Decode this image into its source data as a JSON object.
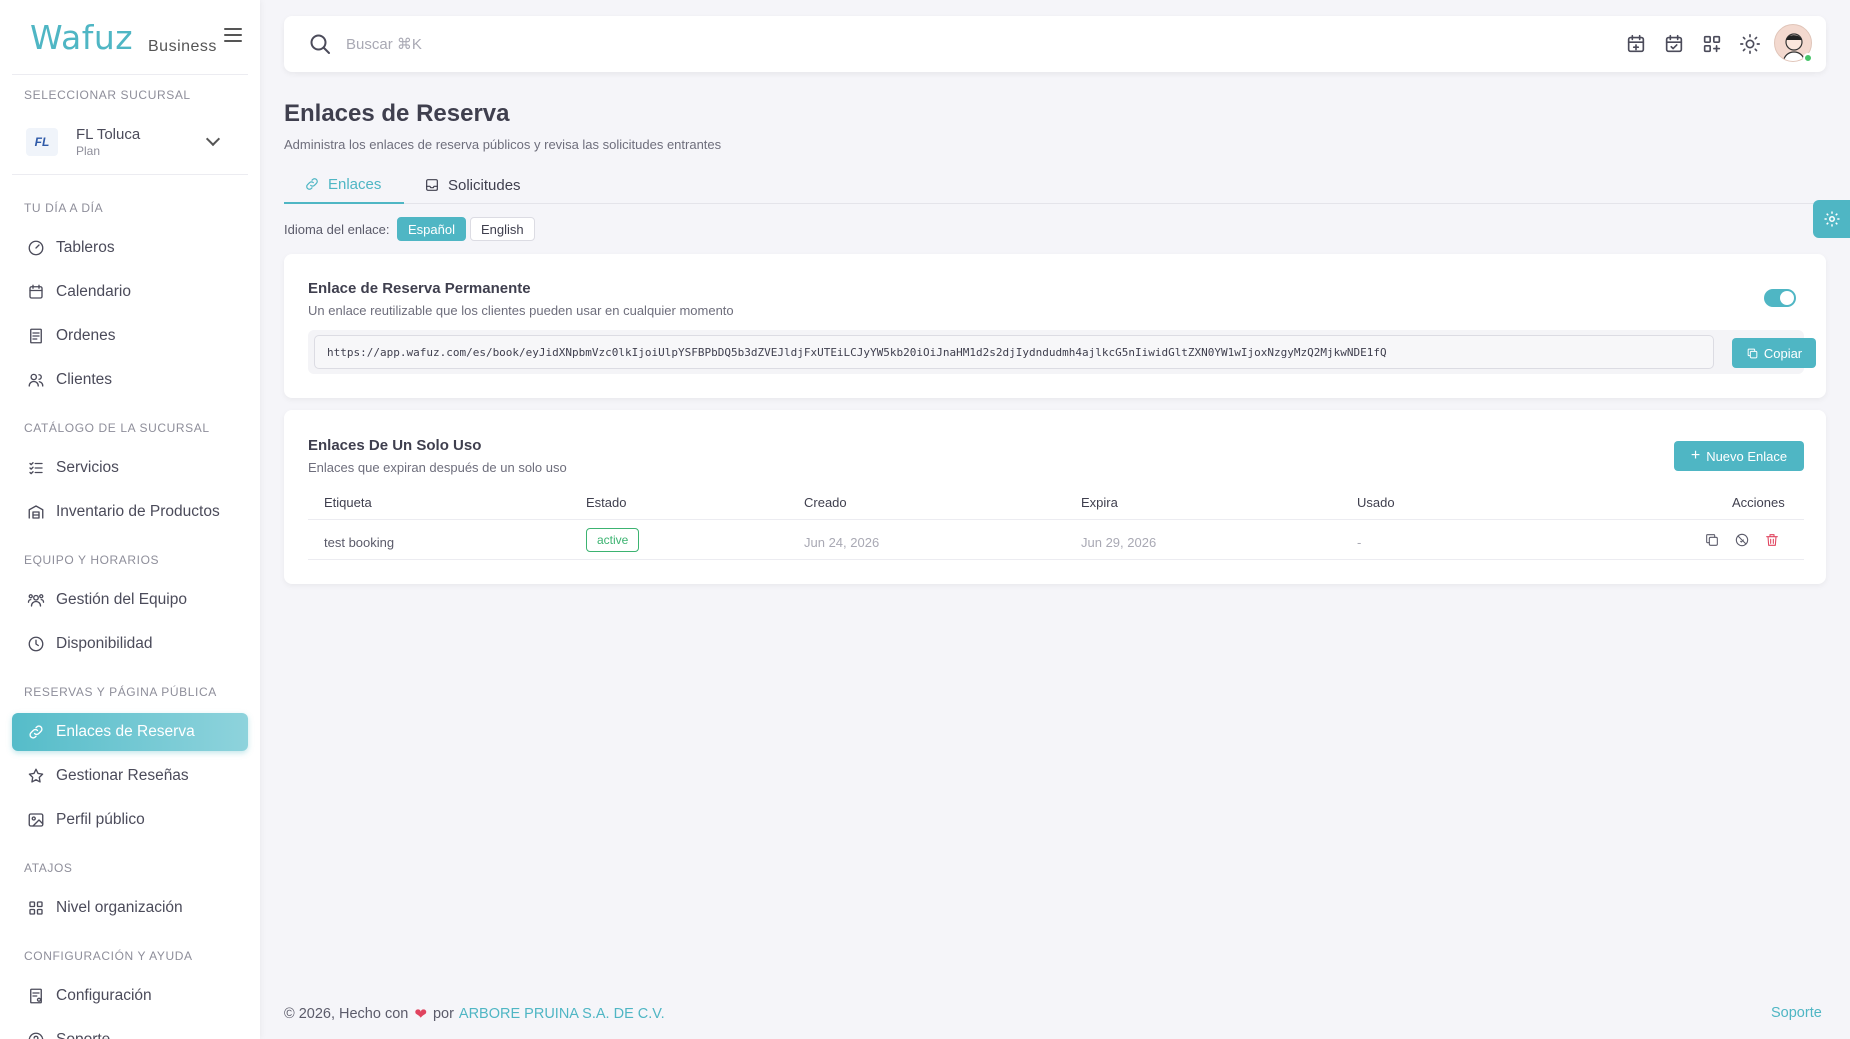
{
  "brand": {
    "logo": "Wafuz",
    "sub": "Business"
  },
  "colors": {
    "accent": "#4fb6c4",
    "active_badge": "#3cb371",
    "danger": "#e0445f"
  },
  "sidebar": {
    "branch_section": "SELECCIONAR SUCURSAL",
    "branch": {
      "logo_text": "FL",
      "name": "FL Toluca",
      "plan": "Plan"
    },
    "sections": {
      "daily": "TU DÍA A DÍA",
      "catalog": "CATÁLOGO DE LA SUCURSAL",
      "team": "EQUIPO Y HORARIOS",
      "bookings": "RESERVAS Y PÁGINA PÚBLICA",
      "shortcuts": "ATAJOS",
      "config": "CONFIGURACIÓN Y AYUDA"
    },
    "items": {
      "tableros": "Tableros",
      "calendario": "Calendario",
      "ordenes": "Ordenes",
      "clientes": "Clientes",
      "servicios": "Servicios",
      "inventario": "Inventario de Productos",
      "gestion_equipo": "Gestión del Equipo",
      "disponibilidad": "Disponibilidad",
      "enlaces": "Enlaces de Reserva",
      "resenas": "Gestionar Reseñas",
      "perfil": "Perfil público",
      "nivel": "Nivel organización",
      "configuracion": "Configuración",
      "soporte": "Soporte"
    }
  },
  "search": {
    "placeholder": "Buscar ⌘K",
    "value": ""
  },
  "page": {
    "title": "Enlaces de Reserva",
    "subtitle": "Administra los enlaces de reserva públicos y revisa las solicitudes entrantes",
    "tabs": {
      "links": "Enlaces",
      "requests": "Solicitudes"
    },
    "language": {
      "label": "Idioma del enlace:",
      "es": "Español",
      "en": "English",
      "selected": "Español"
    }
  },
  "permanent": {
    "title": "Enlace de Reserva Permanente",
    "desc": "Un enlace reutilizable que los clientes pueden usar en cualquier momento",
    "enabled": true,
    "url": "https://app.wafuz.com/es/book/eyJidXNpbmVzc0lkIjoiUlpYSFBPbDQ5b3dZVEJldjFxUTEiLCJyYW5kb20iOiJnaHM1d2s2djIydndudmh4ajlkcG5nIiwidGltZXN0YW1wIjoxNzgyMzQ2MjkwNDE1fQ",
    "copy_label": "Copiar"
  },
  "single_use": {
    "title": "Enlaces De Un Solo Uso",
    "desc": "Enlaces que expiran después de un solo uso",
    "new_label": "Nuevo Enlace",
    "columns": {
      "label": "Etiqueta",
      "status": "Estado",
      "created": "Creado",
      "expires": "Expira",
      "used": "Usado",
      "actions": "Acciones"
    },
    "rows": [
      {
        "label": "test booking",
        "status": "active",
        "created": "Jun 24, 2026",
        "expires": "Jun 29, 2026",
        "used": "-"
      }
    ]
  },
  "footer": {
    "copyright": "© 2026, Hecho con",
    "by": "por",
    "org": "ARBORE PRUINA S.A. DE C.V.",
    "support": "Soporte"
  }
}
